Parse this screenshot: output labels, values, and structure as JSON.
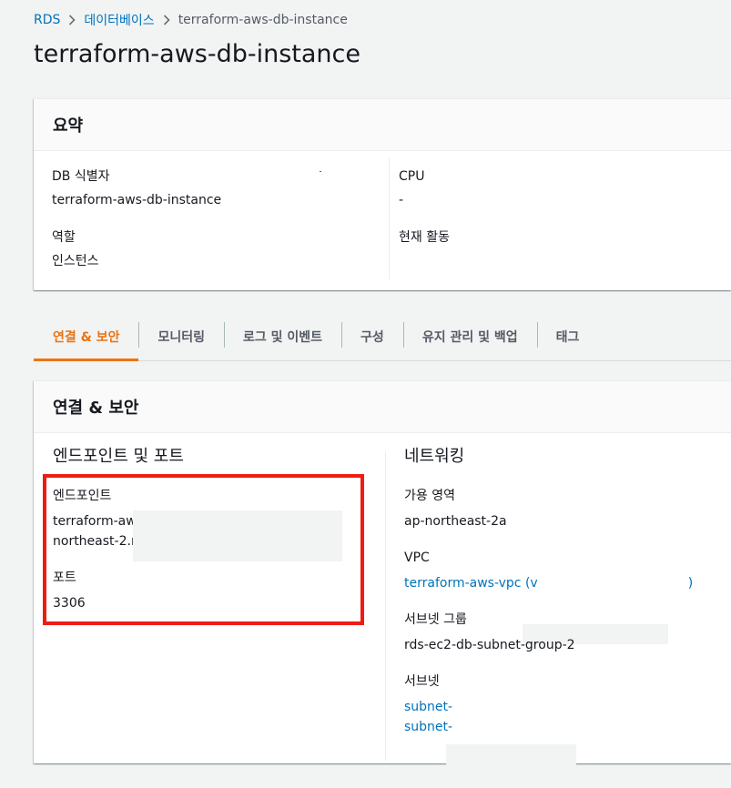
{
  "breadcrumb": {
    "items": [
      "RDS",
      "데이터베이스",
      "terraform-aws-db-instance"
    ]
  },
  "page": {
    "title": "terraform-aws-db-instance"
  },
  "summary": {
    "heading": "요약",
    "db_identifier_label": "DB 식별자",
    "db_identifier_value": "terraform-aws-db-instance",
    "role_label": "역할",
    "role_value": "인스턴스",
    "cpu_label": "CPU",
    "cpu_value": "-",
    "current_activity_label": "현재 활동"
  },
  "tabs": [
    {
      "label": "연결 & 보안",
      "active": true
    },
    {
      "label": "모니터링",
      "active": false
    },
    {
      "label": "로그 및 이벤트",
      "active": false
    },
    {
      "label": "구성",
      "active": false
    },
    {
      "label": "유지 관리 및 백업",
      "active": false
    },
    {
      "label": "태그",
      "active": false
    }
  ],
  "connectivity": {
    "heading": "연결 & 보안",
    "endpoint_section": {
      "title": "엔드포인트 및 포트",
      "endpoint_label": "엔드포인트",
      "endpoint_line1": "terraform-aws",
      "endpoint_line2": "northeast-2.rc",
      "port_label": "포트",
      "port_value": "3306"
    },
    "network_section": {
      "title": "네트워킹",
      "az_label": "가용 영역",
      "az_value": "ap-northeast-2a",
      "vpc_label": "VPC",
      "vpc_value": "terraform-aws-vpc (v",
      "vpc_suffix": ")",
      "subnet_group_label": "서브넷 그룹",
      "subnet_group_value": "rds-ec2-db-subnet-group-2",
      "subnets_label": "서브넷",
      "subnet_1": "subnet-",
      "subnet_2": "subnet-"
    }
  },
  "colors": {
    "link": "#0073bb",
    "accent": "#ec7211",
    "highlight": "#ee1c14",
    "background": "#f2f3f3"
  }
}
